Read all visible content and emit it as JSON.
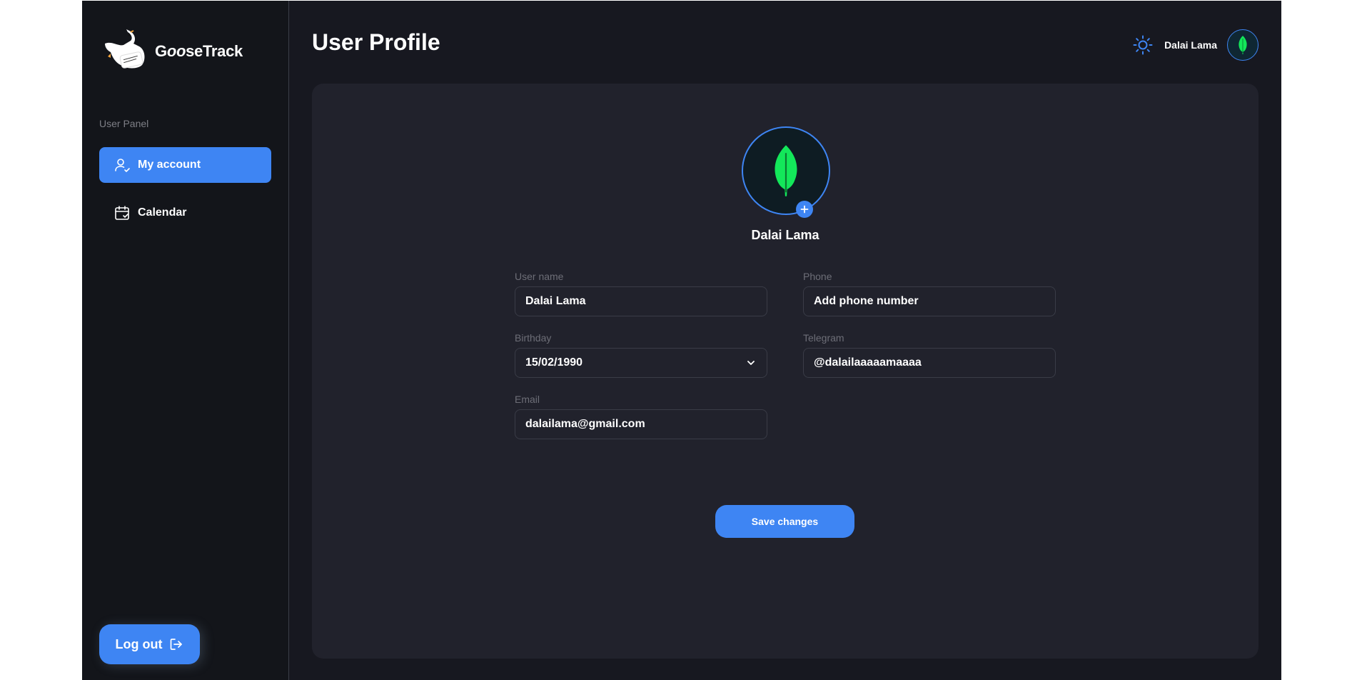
{
  "brand": {
    "name_prefix": "G",
    "name_italic": "oo",
    "name_suffix": "seTrack"
  },
  "sidebar": {
    "section_label": "User Panel",
    "items": [
      {
        "label": "My account",
        "icon": "user-check-icon",
        "active": true
      },
      {
        "label": "Calendar",
        "icon": "calendar-check-icon",
        "active": false
      }
    ],
    "logout_label": "Log out"
  },
  "header": {
    "title": "User Profile",
    "username": "Dalai Lama",
    "theme_icon": "sun-icon"
  },
  "profile": {
    "name": "Dalai Lama",
    "fields": {
      "username": {
        "label": "User name",
        "value": "Dalai Lama"
      },
      "phone": {
        "label": "Phone",
        "value": "Add phone number"
      },
      "birthday": {
        "label": "Birthday",
        "value": "15/02/1990"
      },
      "telegram": {
        "label": "Telegram",
        "value": "@dalailaaaaamaaaa"
      },
      "email": {
        "label": "Email",
        "value": "dalailama@gmail.com"
      }
    },
    "save_label": "Save changes"
  },
  "colors": {
    "accent": "#3e85f3",
    "background": "#171820",
    "sidebar": "#13151a",
    "card": "#21222c",
    "leaf": "#13e75a"
  }
}
